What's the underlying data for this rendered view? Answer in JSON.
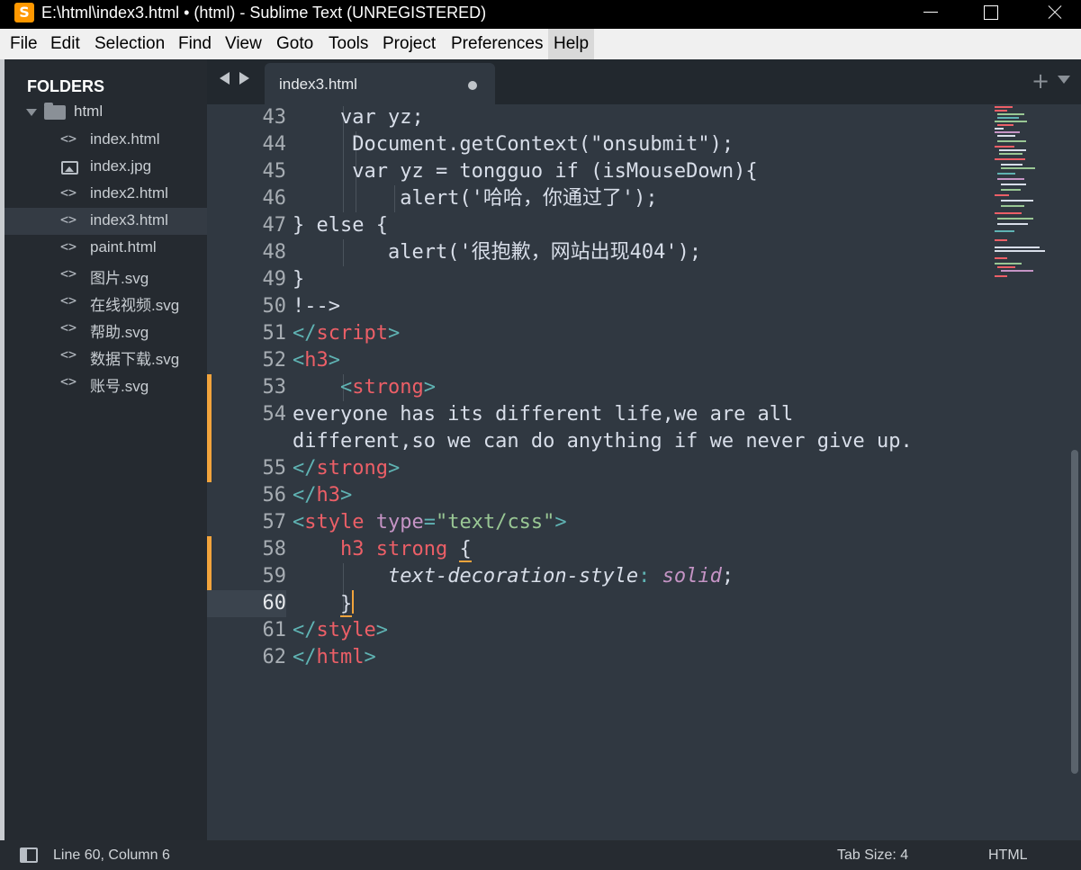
{
  "titlebar": {
    "title": "E:\\html\\index3.html • (html) - Sublime Text (UNREGISTERED)"
  },
  "menu": [
    "File",
    "Edit",
    "Selection",
    "Find",
    "View",
    "Goto",
    "Tools",
    "Project",
    "Preferences",
    "Help"
  ],
  "sidebar": {
    "header": "FOLDERS",
    "root_folder": "html",
    "files": [
      "index.html",
      "index.jpg",
      "index2.html",
      "index3.html",
      "paint.html",
      "图片.svg",
      "在线视频.svg",
      "帮助.svg",
      "数据下载.svg",
      "账号.svg"
    ],
    "selected_file": "index3.html"
  },
  "tab": {
    "label": "index3.html",
    "modified": true
  },
  "editor": {
    "line_numbers": [
      "43",
      "44",
      "45",
      "46",
      "47",
      "48",
      "49",
      "50",
      "51",
      "52",
      "53",
      "54",
      "",
      "55",
      "56",
      "57",
      "58",
      "59",
      "60",
      "61",
      "62"
    ],
    "current_line": "60",
    "code": {
      "l43": "    var yz;",
      "l44": "     Document.getContext(\"onsubmit\");",
      "l45": "     var yz = tongguo if (isMouseDown){",
      "l46": "         alert('哈哈，你通过了');",
      "l47": "} else {",
      "l48": "        alert('很抱歉，网站出现404');",
      "l49": "}",
      "l50": "!-->",
      "l51_open": "</",
      "l51_tag": "script",
      "l51_close": ">",
      "l52_open": "<",
      "l52_tag": "h3",
      "l52_close": ">",
      "l53_indent": "    ",
      "l53_open": "<",
      "l53_tag": "strong",
      "l53_close": ">",
      "l54a": "everyone has its different life,we are all",
      "l54b": "different,so we can do anything if we never give up.",
      "l55_open": "</",
      "l55_tag": "strong",
      "l55_close": ">",
      "l56_open": "</",
      "l56_tag": "h3",
      "l56_close": ">",
      "l57_open": "<",
      "l57_tag": "style",
      "l57_sp": " ",
      "l57_attr": "type",
      "l57_eq": "=",
      "l57_str": "\"text/css\"",
      "l57_close": ">",
      "l58_indent": "    ",
      "l58_sel": "h3 strong",
      "l58_sp": " ",
      "l58_brace": "{",
      "l59_indent": "        ",
      "l59_prop": "text-decoration-style",
      "l59_colon": ": ",
      "l59_val": "solid",
      "l59_semi": ";",
      "l60_indent": "    ",
      "l60_brace": "}",
      "l61_open": "</",
      "l61_tag": "style",
      "l61_close": ">",
      "l62_open": "</",
      "l62_tag": "html",
      "l62_close": ">"
    }
  },
  "status": {
    "position": "Line 60, Column 6",
    "tab_size": "Tab Size: 4",
    "syntax": "HTML"
  },
  "colors": {
    "accent": "#f2a43c",
    "background": "#303841",
    "tag": "#ec5f67",
    "punctuation": "#5fb3b3",
    "string": "#99c794",
    "attribute": "#c594c5"
  }
}
